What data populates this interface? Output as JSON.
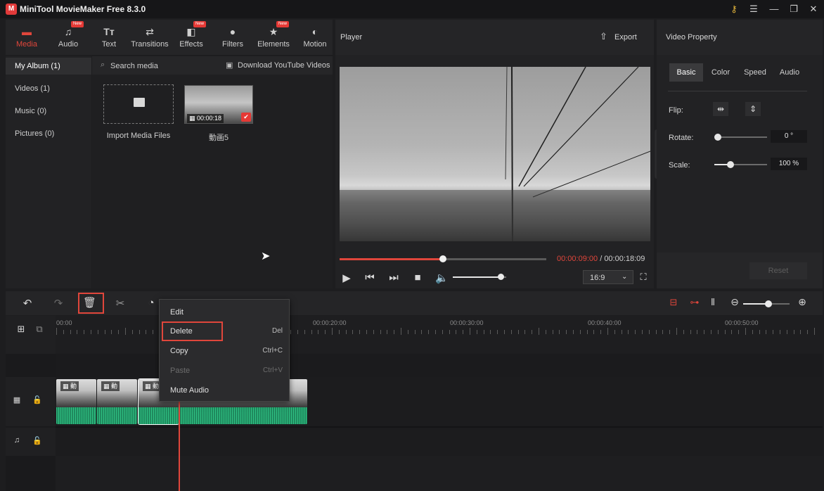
{
  "app": {
    "title": "MiniTool MovieMaker Free 8.3.0",
    "logo_letter": "M"
  },
  "window_controls": [
    "key-icon",
    "menu-icon",
    "minimize-icon",
    "maximize-icon",
    "close-icon"
  ],
  "toolbar": {
    "tabs": [
      {
        "label": "Media",
        "icon": "folder-icon",
        "active": true,
        "badge": ""
      },
      {
        "label": "Audio",
        "icon": "music-note-icon",
        "active": false,
        "badge": "New"
      },
      {
        "label": "Text",
        "icon": "text-icon",
        "active": false,
        "badge": ""
      },
      {
        "label": "Transitions",
        "icon": "transition-icon",
        "active": false,
        "badge": ""
      },
      {
        "label": "Effects",
        "icon": "effects-icon",
        "active": false,
        "badge": "New"
      },
      {
        "label": "Filters",
        "icon": "filters-icon",
        "active": false,
        "badge": ""
      },
      {
        "label": "Elements",
        "icon": "elements-icon",
        "active": false,
        "badge": "New"
      },
      {
        "label": "Motion",
        "icon": "motion-icon",
        "active": false,
        "badge": ""
      }
    ]
  },
  "sidebar": {
    "items": [
      {
        "label": "My Album (1)",
        "selected": true
      },
      {
        "label": "Videos (1)",
        "selected": false
      },
      {
        "label": "Music (0)",
        "selected": false
      },
      {
        "label": "Pictures (0)",
        "selected": false
      }
    ]
  },
  "media": {
    "search_placeholder": "Search media",
    "youtube_label": "Download YouTube Videos",
    "import_label": "Import Media Files",
    "clip": {
      "name": "動画5",
      "duration": "00:00:18"
    }
  },
  "player": {
    "title": "Player",
    "export_label": "Export",
    "current_time": "00:00:09:00",
    "separator": "/",
    "total_time": "00:00:18:09",
    "progress": 0.5,
    "volume": 0.9,
    "aspect_ratio": "16:9"
  },
  "props": {
    "title": "Video Property",
    "tabs": [
      {
        "label": "Basic",
        "active": true
      },
      {
        "label": "Color",
        "active": false
      },
      {
        "label": "Speed",
        "active": false
      },
      {
        "label": "Audio",
        "active": false
      }
    ],
    "flip_label": "Flip:",
    "rotate_label": "Rotate:",
    "rotate_value": "0 °",
    "rotate_level": 0.0,
    "scale_label": "Scale:",
    "scale_value": "100 %",
    "scale_level": 0.3,
    "reset_label": "Reset"
  },
  "timeline": {
    "ruler_labels": [
      "00:00",
      "00:00:20:00",
      "00:00:30:00",
      "00:00:40:00",
      "00:00:50:00"
    ],
    "clip_label": "動",
    "zoom_level": 0.55
  },
  "context_menu": {
    "items": [
      {
        "label": "Edit",
        "shortcut": "",
        "disabled": false
      },
      {
        "label": "Delete",
        "shortcut": "Del",
        "disabled": false
      },
      {
        "label": "Copy",
        "shortcut": "Ctrl+C",
        "disabled": false
      },
      {
        "label": "Paste",
        "shortcut": "Ctrl+V",
        "disabled": true
      },
      {
        "label": "Mute Audio",
        "shortcut": "",
        "disabled": false
      }
    ]
  },
  "colors": {
    "accent": "#e0463b",
    "audio_wave": "#2fc083",
    "bg": "#1d1d1f"
  }
}
